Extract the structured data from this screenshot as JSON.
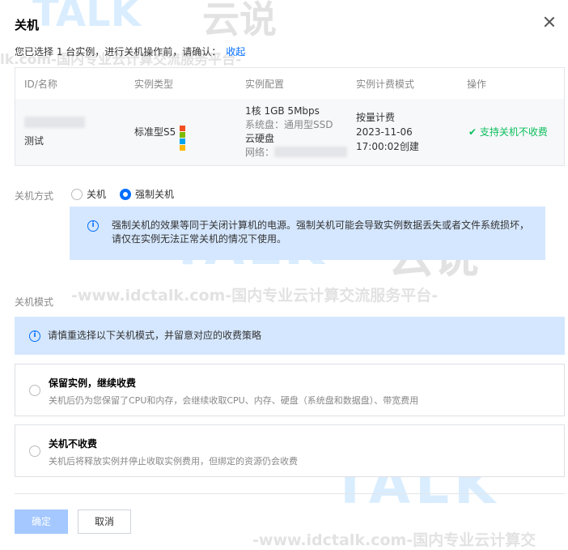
{
  "dialog": {
    "title": "关机",
    "confirm_text": "您已选择 1 台实例，进行关机操作前，请确认：",
    "collapse_link": "收起"
  },
  "table": {
    "headers": [
      "ID/名称",
      "实例类型",
      "实例配置",
      "实例计费模式",
      "操作"
    ],
    "row": {
      "name": "测试",
      "type": "标准型S5",
      "os_icon": "windows-icon",
      "config_line1": "1核 1GB 5Mbps",
      "config_line2": "系统盘：通用型SSD",
      "config_line3": "云硬盘",
      "config_net_label": "网络：",
      "billing_line1": "按量计费",
      "billing_line2": "2023-11-06",
      "billing_line3": "17:00:02创建",
      "status": "支持关机不收费",
      "status_icon": "check-icon"
    }
  },
  "shutdown_method": {
    "label": "关机方式",
    "options": [
      "关机",
      "强制关机"
    ],
    "selected": "强制关机",
    "info": "强制关机的效果等同于关闭计算机的电源。强制关机可能会导致实例数据丢失或者文件系统损坏，请仅在实例无法正常关机的情况下使用。"
  },
  "shutdown_mode": {
    "label": "关机模式",
    "info": "请慎重选择以下关机模式，并留意对应的收费策略",
    "options": [
      {
        "title": "保留实例，继续收费",
        "desc": "关机后仍为您保留了CPU和内存，会继续收取CPU、内存、硬盘（系统盘和数据盘）、带宽费用"
      },
      {
        "title": "关机不收费",
        "desc": "关机后将释放实例并停止收取实例费用，但绑定的资源仍会收费"
      }
    ]
  },
  "buttons": {
    "ok": "确定",
    "cancel": "取消"
  },
  "watermark": {
    "brand": "TALK",
    "brand_cn": "云说",
    "slogan": "-www.idctalk.com-国内专业云计算交流服务平台-",
    "slogan_top": "lk.com-国内专业云计算交流服务平台-",
    "slogan_bottom": "-www.idctalk.com-国内专业云计算交"
  },
  "colors": {
    "primary": "#006eff",
    "success": "#0abf5b",
    "info_bg": "#d5e7ff"
  }
}
